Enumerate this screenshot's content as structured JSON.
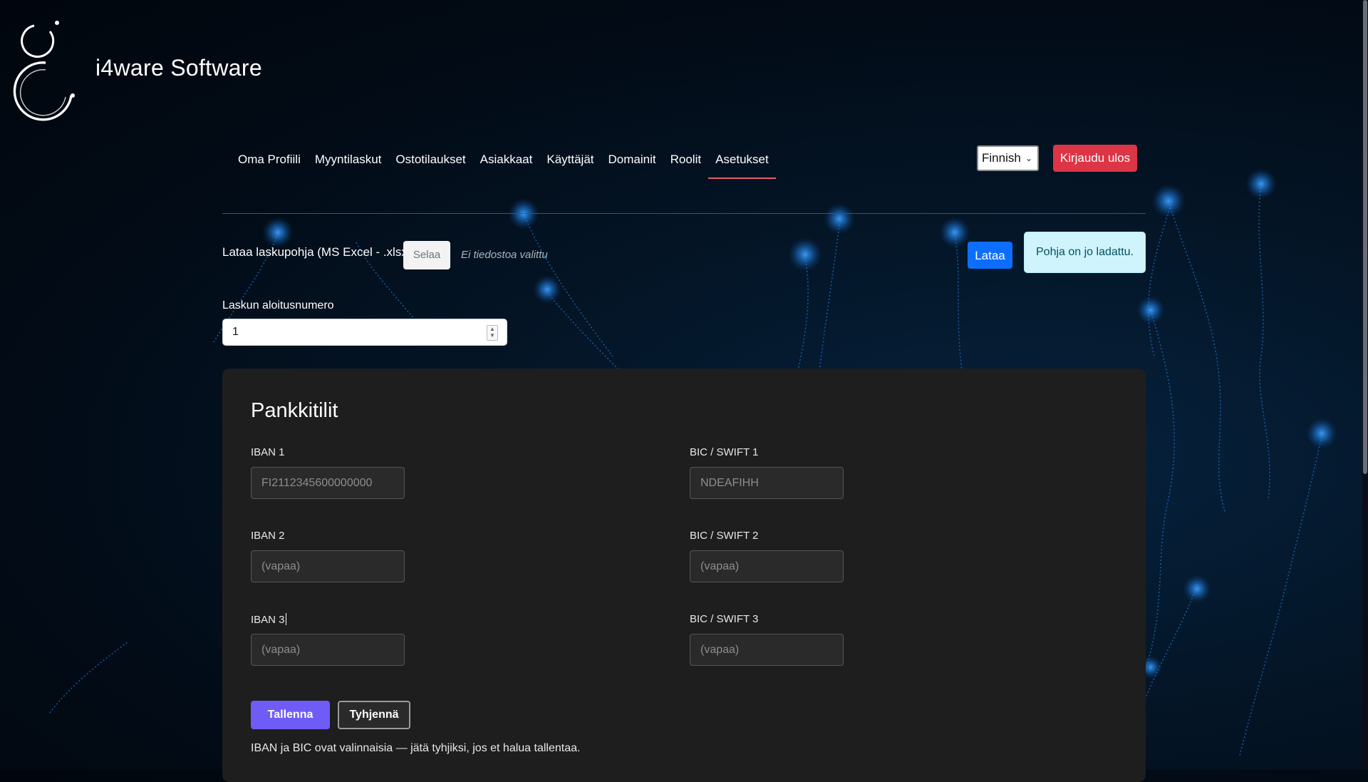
{
  "brand": {
    "name": "i4ware Software"
  },
  "nav": {
    "items": [
      "Oma Profiili",
      "Myyntilaskut",
      "Ostotilaukset",
      "Asiakkaat",
      "Käyttäjät",
      "Domainit",
      "Roolit",
      "Asetukset"
    ],
    "active": "Asetukset"
  },
  "header": {
    "language": "Finnish",
    "logout_label": "Kirjaudu ulos"
  },
  "upload": {
    "label": "Lataa laskupohja (MS Excel - .xlsx)",
    "browse_label": "Selaa",
    "no_file_text": "Ei tiedostoa valittu",
    "upload_label": "Lataa",
    "alert_text": "Pohja on jo ladattu."
  },
  "invoice_start": {
    "label": "Laskun aloitusnumero",
    "value": "1"
  },
  "bank": {
    "title": "Pankkitilit",
    "iban1_label": "IBAN 1",
    "iban1_value": "FI2112345600000000",
    "bic1_label": "BIC / SWIFT 1",
    "bic1_value": "NDEAFIHH",
    "iban2_label": "IBAN 2",
    "iban2_placeholder": "(vapaa)",
    "bic2_label": "BIC / SWIFT 2",
    "bic2_placeholder": "(vapaa)",
    "iban3_label": "IBAN 3",
    "iban3_placeholder": "(vapaa)",
    "bic3_label": "BIC / SWIFT 3",
    "bic3_placeholder": "(vapaa)",
    "save_label": "Tallenna",
    "clear_label": "Tyhjennä",
    "hint": "IBAN ja BIC ovat valinnaisia — jätä tyhjiksi, jos et halua tallentaa."
  },
  "colors": {
    "accent_purple": "#6f5cf6",
    "danger": "#dc3545",
    "primary": "#0d6efd",
    "info_bg": "#cff4fc",
    "card_bg": "#1e1e1e"
  }
}
